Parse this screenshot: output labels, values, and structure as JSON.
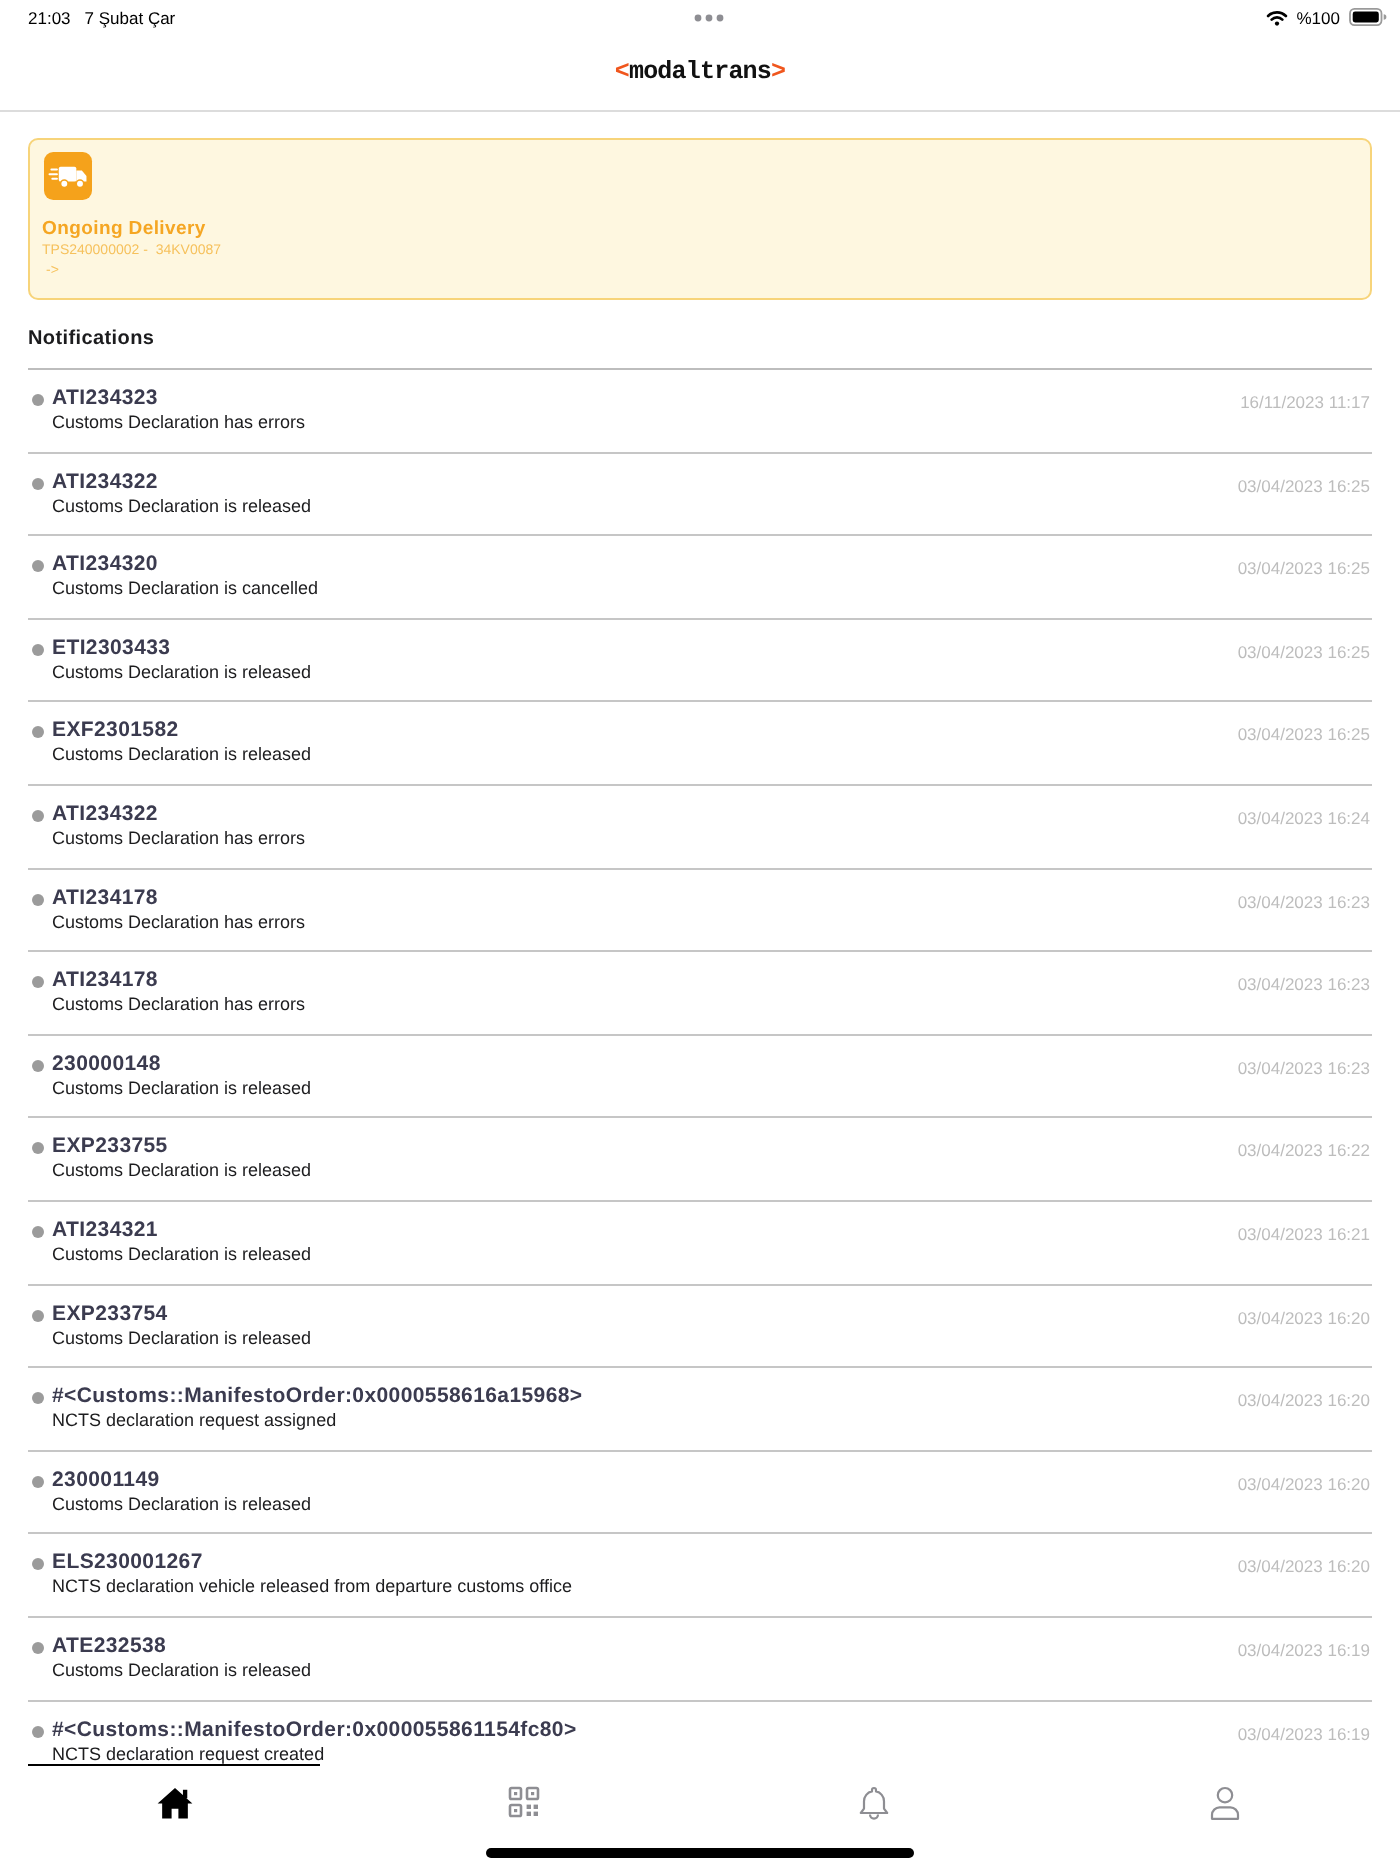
{
  "status_bar": {
    "time": "21:03",
    "date": "7 Şubat Çar",
    "battery": "%100"
  },
  "header": {
    "logo": {
      "prefix": "<",
      "name": "modaltrans",
      "suffix": ">"
    }
  },
  "ongoing_delivery": {
    "title": "Ongoing Delivery",
    "reference": "TPS240000002 -  34KV0087",
    "link": "->"
  },
  "notifications": {
    "heading": "Notifications",
    "items": [
      {
        "reference": "ATI234323",
        "message": "Customs Declaration has errors",
        "time": "16/11/2023 11:17"
      },
      {
        "reference": "ATI234322",
        "message": "Customs Declaration is released",
        "time": "03/04/2023 16:25"
      },
      {
        "reference": "ATI234320",
        "message": "Customs Declaration is cancelled",
        "time": "03/04/2023 16:25"
      },
      {
        "reference": "ETI2303433",
        "message": "Customs Declaration is released",
        "time": "03/04/2023 16:25"
      },
      {
        "reference": "EXF2301582",
        "message": "Customs Declaration is released",
        "time": "03/04/2023 16:25"
      },
      {
        "reference": "ATI234322",
        "message": "Customs Declaration has errors",
        "time": "03/04/2023 16:24"
      },
      {
        "reference": "ATI234178",
        "message": "Customs Declaration has errors",
        "time": "03/04/2023 16:23"
      },
      {
        "reference": "ATI234178",
        "message": "Customs Declaration has errors",
        "time": "03/04/2023 16:23"
      },
      {
        "reference": "230000148",
        "message": "Customs Declaration is released",
        "time": "03/04/2023 16:23"
      },
      {
        "reference": "EXP233755",
        "message": "Customs Declaration is released",
        "time": "03/04/2023 16:22"
      },
      {
        "reference": "ATI234321",
        "message": "Customs Declaration is released",
        "time": "03/04/2023 16:21"
      },
      {
        "reference": "EXP233754",
        "message": "Customs Declaration is released",
        "time": "03/04/2023 16:20"
      },
      {
        "reference": "#<Customs::ManifestoOrder:0x0000558616a15968>",
        "message": "NCTS declaration request assigned",
        "time": "03/04/2023 16:20"
      },
      {
        "reference": "230001149",
        "message": "Customs Declaration is released",
        "time": "03/04/2023 16:20"
      },
      {
        "reference": "ELS230001267",
        "message": "NCTS declaration vehicle released from departure customs office",
        "time": "03/04/2023 16:20"
      },
      {
        "reference": "ATE232538",
        "message": "Customs Declaration is released",
        "time": "03/04/2023 16:19"
      },
      {
        "reference": "#<Customs::ManifestoOrder:0x000055861154fc80>",
        "message": "NCTS declaration request created",
        "time": "03/04/2023 16:19"
      }
    ]
  },
  "tab_bar": {
    "tabs": [
      {
        "kind": "home",
        "selected": true
      },
      {
        "kind": "qr",
        "selected": false
      },
      {
        "kind": "bell",
        "selected": false
      },
      {
        "kind": "person",
        "selected": false
      }
    ]
  }
}
